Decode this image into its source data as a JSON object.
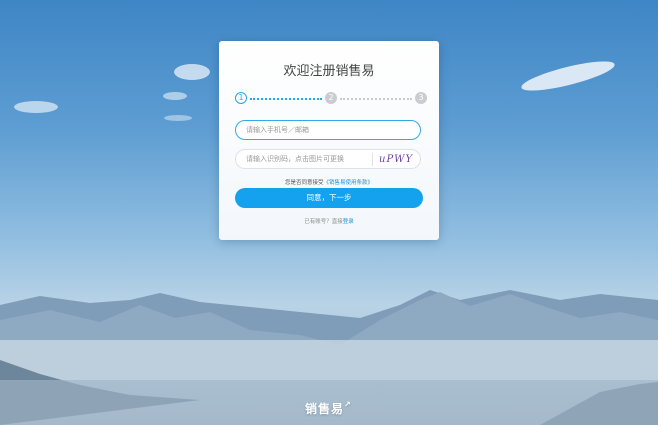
{
  "card": {
    "title": "欢迎注册销售易",
    "steps": [
      "1",
      "2",
      "3"
    ],
    "account_placeholder": "请输入手机号／邮箱",
    "captcha_placeholder": "请输入识别码，点击图片可更换",
    "captcha_text": "uPWY",
    "agree_prefix": "您是否同意接受",
    "agree_link": "《销售易使用条款》",
    "next_button": "同意，下一步",
    "login_prefix": "已有账号？直接",
    "login_link": "登录"
  },
  "footer": {
    "brand": "销售易",
    "brand_arrow": "↗"
  },
  "colors": {
    "accent": "#14a2ee",
    "active_step": "#28a6e8",
    "inactive_step": "#c9ccd0"
  }
}
